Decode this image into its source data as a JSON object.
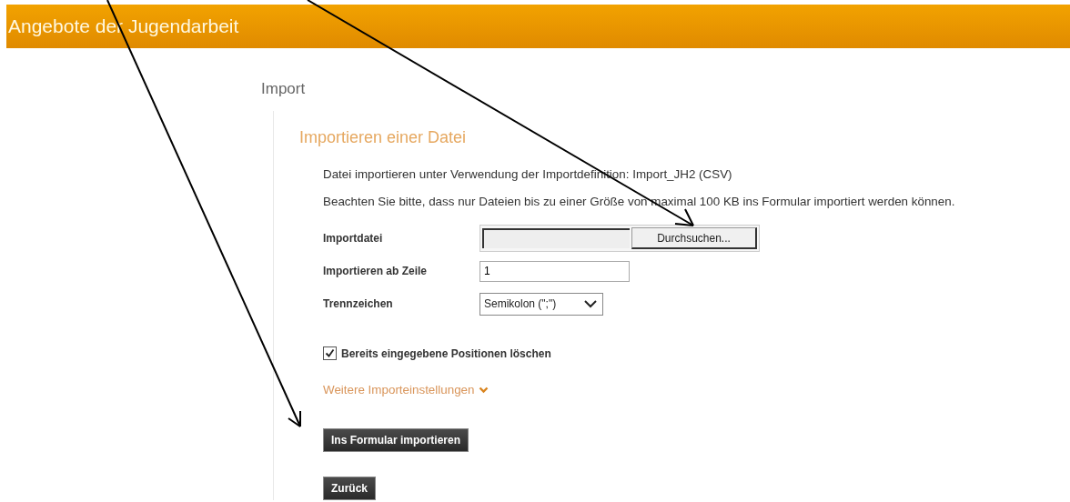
{
  "header": {
    "title": "Angebote der Jugendarbeit"
  },
  "page_title": "Import",
  "section": {
    "heading": "Importieren einer Datei",
    "info": [
      "Datei importieren unter Verwendung der Importdefinition: Import_JH2 (CSV)",
      "Beachten Sie bitte, dass nur Dateien bis zu einer Größe von maximal 100 KB ins Formular importiert werden können."
    ]
  },
  "fields": [
    {
      "kind": "file",
      "label": "Importdatei",
      "button": "Durchsuchen..."
    },
    {
      "kind": "text",
      "label": "Importieren ab Zeile",
      "value": "1"
    },
    {
      "kind": "select",
      "label": "Trennzeichen",
      "value": "Semikolon (\";\")"
    }
  ],
  "checkbox": {
    "label": "Bereits eingegebene Positionen löschen",
    "checked": true
  },
  "more_link": {
    "label": "Weitere Importeinstellungen",
    "expanded": false
  },
  "buttons": [
    "Ins Formular importieren",
    "Zurück"
  ]
}
